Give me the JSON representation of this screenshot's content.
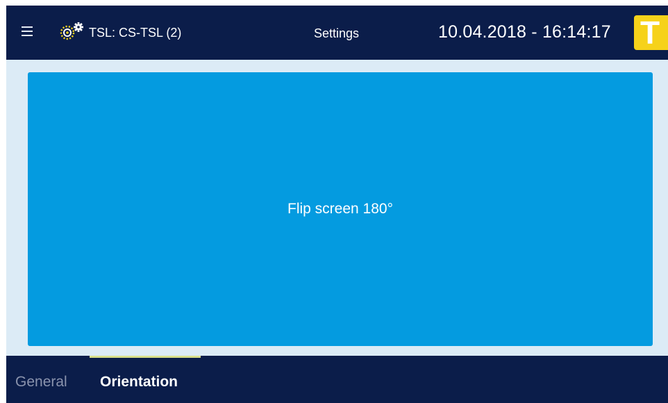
{
  "header": {
    "menu_icon": "hamburger-menu-icon",
    "device_icon": "gears-icon",
    "device_label": "TSL: CS-TSL (2)",
    "title": "Settings",
    "datetime": "10.04.2018 - 16:14:17",
    "logo_letter": "T",
    "logo_color": "#f6d21a"
  },
  "main": {
    "flip_button_label": "Flip screen 180°",
    "flip_button_color": "#049be0"
  },
  "tabs": [
    {
      "label": "General",
      "active": false
    },
    {
      "label": "Orientation",
      "active": true
    }
  ],
  "colors": {
    "bar_background": "#0b1d4a",
    "content_background": "#dcebf6",
    "active_tab_indicator": "#d9df8a"
  }
}
